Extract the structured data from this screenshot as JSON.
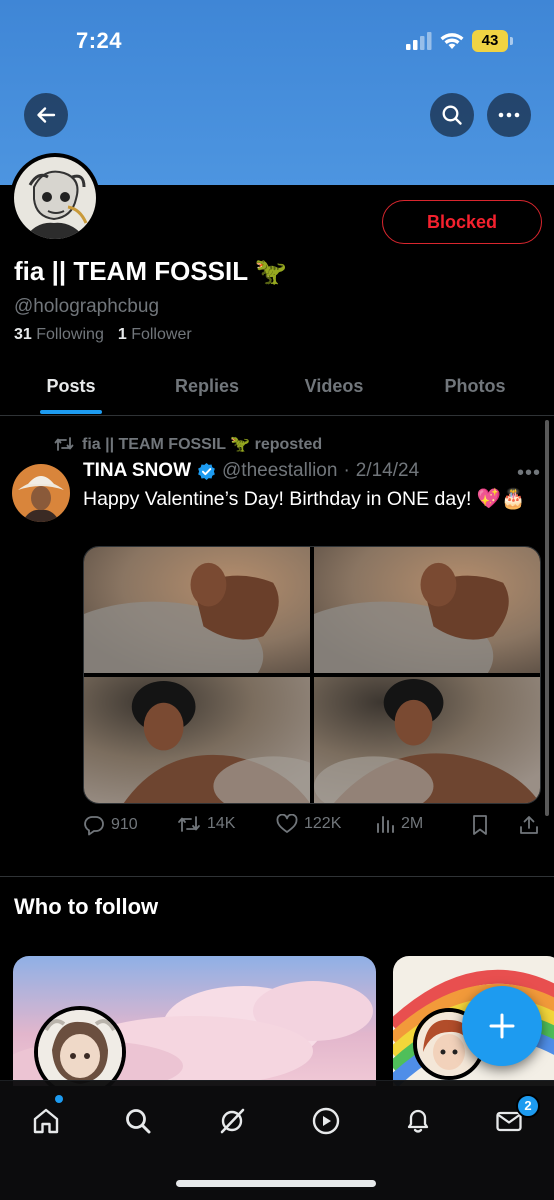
{
  "status_bar": {
    "time": "7:24",
    "battery": "43"
  },
  "header": {
    "back_icon": "arrow-left-icon",
    "search_icon": "search-icon",
    "more_icon": "more-horizontal-icon"
  },
  "profile": {
    "display_name": "fia || TEAM FOSSIL 🦖",
    "handle": "@holographcbug",
    "following_count": "31",
    "following_label": "Following",
    "followers_count": "1",
    "followers_label": "Follower",
    "blocked_label": "Blocked"
  },
  "tabs": [
    {
      "label": "Posts",
      "active": true
    },
    {
      "label": "Replies",
      "active": false
    },
    {
      "label": "Videos",
      "active": false
    },
    {
      "label": "Photos",
      "active": false
    }
  ],
  "post": {
    "repost_text": "fia || TEAM FOSSIL 🦖 reposted",
    "author_name": "TINA SNOW",
    "verified": true,
    "author_handle": "@theestallion",
    "separator": "·",
    "date": "2/14/24",
    "text": "Happy Valentine’s Day! Birthday in ONE day! 💖🎂",
    "media_count": 4,
    "replies": "910",
    "reposts": "14K",
    "likes": "122K",
    "views": "2M"
  },
  "who_to_follow": {
    "title": "Who to follow"
  },
  "bottom_nav": {
    "items": [
      "home-icon",
      "search-icon",
      "grok-icon",
      "video-icon",
      "notifications-icon",
      "messages-icon"
    ],
    "messages_badge": "2"
  },
  "colors": {
    "accent": "#1d9bf0",
    "blocked": "#f4212e",
    "banner": "#4a90dc"
  }
}
